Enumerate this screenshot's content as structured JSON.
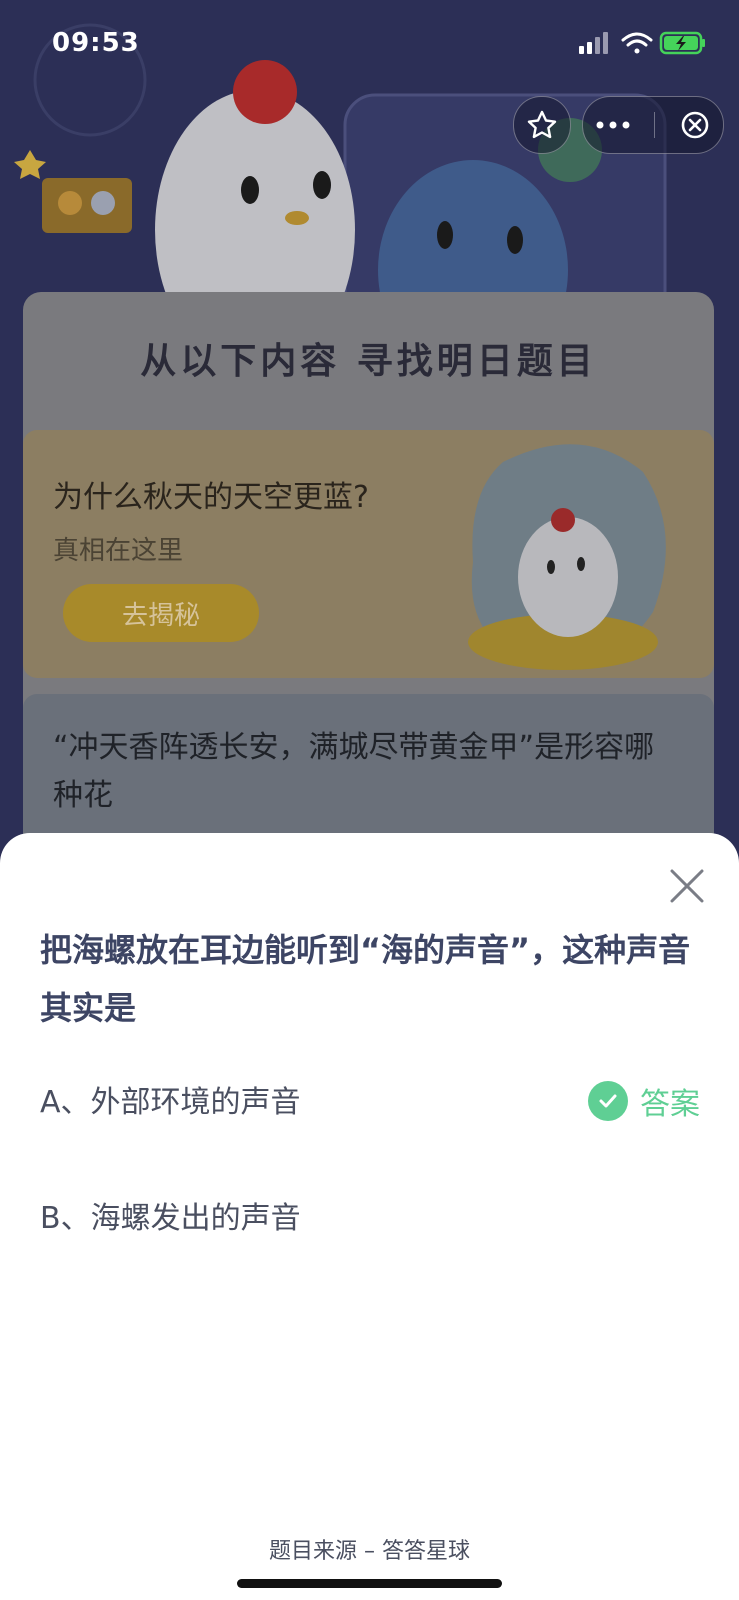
{
  "status_bar": {
    "time": "09:53"
  },
  "header": {
    "section_title": "从以下内容 寻找明日题目"
  },
  "topic_cards": [
    {
      "question": "为什么秋天的天空更蓝?",
      "subtitle": "真相在这里",
      "button_label": "去揭秘"
    },
    {
      "question": "“冲天香阵透长安，满城尽带黄金甲”是形容哪种花"
    }
  ],
  "sheet": {
    "question": "把海螺放在耳边能听到“海的声音”，这种声音其实是",
    "options": [
      {
        "label": "A、外部环境的声音",
        "is_answer": true
      },
      {
        "label": "B、海螺发出的声音",
        "is_answer": false
      }
    ],
    "answer_badge": "答案",
    "source": "题目来源 – 答答星球"
  },
  "colors": {
    "accent_green": "#5fcf94",
    "question_text": "#3d4564",
    "option_text": "#4a4f60"
  }
}
